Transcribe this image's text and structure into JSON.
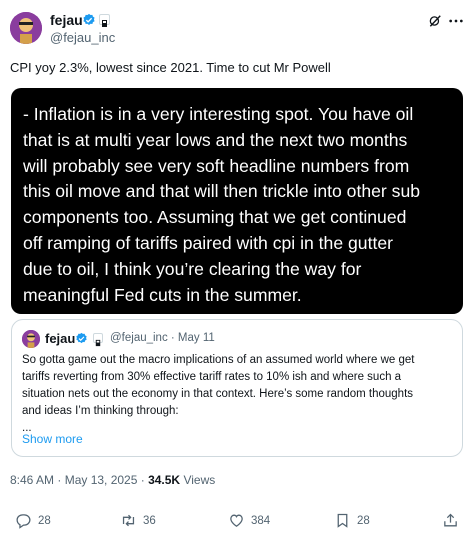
{
  "author": {
    "name": "fejau",
    "handle": "@fejau_inc"
  },
  "post": {
    "text": "CPI yoy 2.3%, lowest since 2021. Time to cut Mr Powell"
  },
  "media": {
    "lines": [
      "- Inflation is in a very interesting spot. You have oil",
      "that is at multi year lows and the next two months",
      "will probably see very soft headline numbers from",
      "this oil move and that will then trickle into other sub",
      "components too. Assuming that we get continued",
      "off ramping of tariffs paired with cpi in the gutter",
      "due to oil, I think you’re clearing the way for",
      "meaningful Fed cuts in the summer."
    ]
  },
  "quote": {
    "name": "fejau",
    "handle_date": "@fejau_inc · May 11",
    "lines": [
      "So gotta game out the macro implications of an assumed world where we get",
      "tariffs reverting from 30% effective tariff rates to 10% ish and where such a",
      "situation nets out the economy in that context. Here’s some random thoughts",
      "and ideas I’m thinking through:",
      "..."
    ],
    "show_more": "Show more"
  },
  "meta": {
    "timestamp": "8:46 AM · May 13, 2025 · ",
    "views_count": "34.5K",
    "views_label": " Views"
  },
  "actions": {
    "replies": "28",
    "reposts": "36",
    "likes": "384",
    "bookmarks": "28"
  },
  "colors": {
    "verified": "#1d9bf0",
    "link": "#1d9bf0",
    "secondary_text": "#536471",
    "media_bg": "#000000"
  }
}
